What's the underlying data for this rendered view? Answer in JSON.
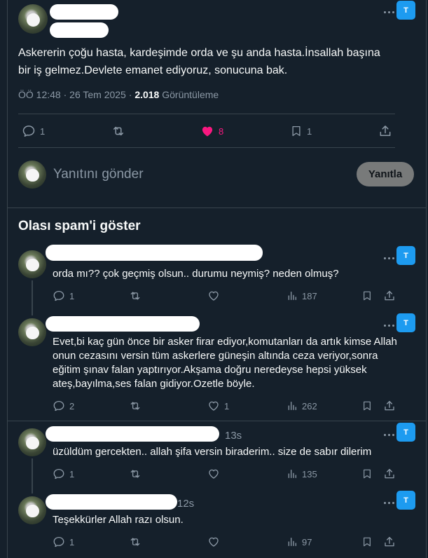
{
  "main_tweet": {
    "text_lines": [
      "Askererin çoğu hasta, kardeşimde orda ve şu anda hasta.İnsallah başına",
      "bir iş gelmez.Devlete emanet ediyoruz, sonucuna bak."
    ],
    "time": "ÖÖ 12:48",
    "sep1": "·",
    "date": "26 Tem 2025",
    "sep2": "·",
    "views_count": "2.018",
    "views_label": "Görüntüleme",
    "badge": "T",
    "actions": {
      "replies": "1",
      "likes": "8",
      "bookmarks": "1"
    }
  },
  "composer": {
    "placeholder": "Yanıtını gönder",
    "button_label": "Yanıtla"
  },
  "spam_section": {
    "title": "Olası spam'i göster"
  },
  "replies": [
    {
      "text_lines": [
        "orda mı?? çok geçmiş olsun.. durumu neymiş? neden olmuş?"
      ],
      "time_suffix": "",
      "badge": "T",
      "replies": "1",
      "likes": "",
      "views": "187"
    },
    {
      "text_lines": [
        "Evet,bi kaç gün önce bir asker firar ediyor,komutanları da artık kimse Allah",
        "onun cezasını versin tüm askerlere güneşin altında ceza veriyor,sonra",
        "eğitim şınav falan yaptırıyor.Akşama doğru neredeyse hepsi yüksek",
        "ateş,bayılma,ses falan gidiyor.Ozetle böyle."
      ],
      "time_suffix": "",
      "badge": "T",
      "replies": "2",
      "likes": "1",
      "views": "262"
    },
    {
      "text_lines": [
        "üzüldüm gercekten.. allah şifa versin biraderim.. size de sabır dilerim"
      ],
      "time_suffix": "13s",
      "badge": "T",
      "replies": "1",
      "likes": "",
      "views": "135"
    },
    {
      "text_lines": [
        "Teşekkürler Allah razı olsun."
      ],
      "time_suffix": "12s",
      "badge": "T",
      "replies": "1",
      "likes": "",
      "views": "97"
    }
  ],
  "colors": {
    "background": "#15202b",
    "like_active": "#f91880",
    "accent": "#1d9bf0",
    "muted": "#8b98a5"
  }
}
